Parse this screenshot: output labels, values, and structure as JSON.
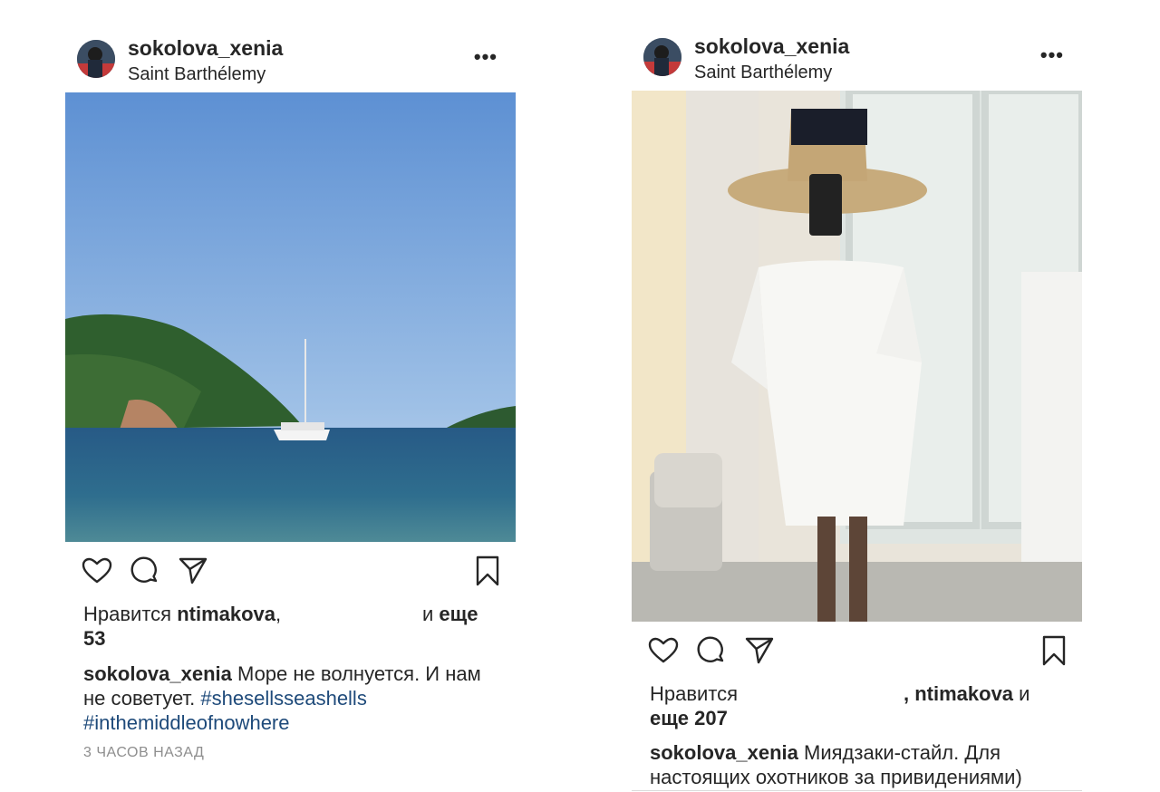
{
  "left_post": {
    "username": "sokolova_xenia",
    "location": "Saint Barthélemy",
    "more_label": "•••",
    "likes": {
      "prefix": "Нравится",
      "user": "ntimakova",
      "comma": ",",
      "and": "и",
      "more": "еще",
      "count": "53"
    },
    "caption": {
      "username": "sokolova_xenia",
      "text": "Море не волнуется. И нам не советует.",
      "hashtag1": "#shesellsseashells",
      "hashtag2": "#inthemiddleofnowhere"
    },
    "timestamp": "3 ЧАСОВ НАЗАД"
  },
  "right_post": {
    "username": "sokolova_xenia",
    "location": "Saint Barthélemy",
    "more_label": "•••",
    "likes": {
      "prefix": "Нравится",
      "comma_user": ", ntimakova",
      "and": "и",
      "more": "еще 207"
    },
    "caption": {
      "username": "sokolova_xenia",
      "text": "Миядзаки-стайл. Для настоящих охотников за привидениями)"
    }
  },
  "colors": {
    "text": "#262626",
    "hashtag": "#1e4a7a",
    "muted": "#8e8e8e",
    "sky": "#6f9fd6",
    "sea": "#2e5f82"
  }
}
